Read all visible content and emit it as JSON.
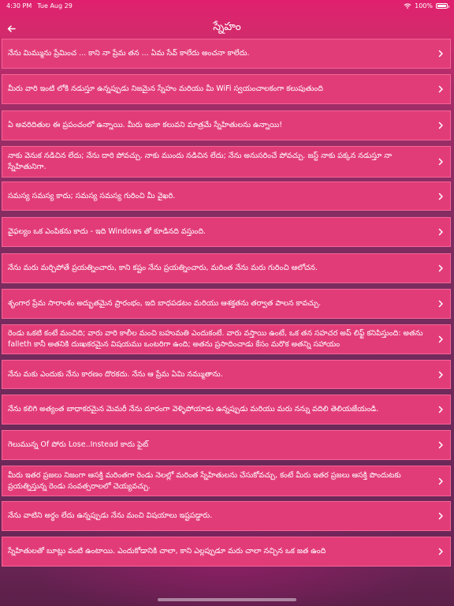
{
  "status": {
    "time": "4:30 PM",
    "date": "Tue Aug 29",
    "battery": "100%",
    "battery_level": 1.0
  },
  "header": {
    "title": "స్నేహం"
  },
  "items": [
    {
      "text": "నేను మిమ్మును ప్రేమించ ... కాని నా ప్రేమ తన ... ఏమ సేవ్ కాలేదు అంచనా కాలేదు."
    },
    {
      "text": "మీరు వారి ఇంటి లోకి నడుస్తూ ఉన్నప్పుడు నిజమైన స్నేహం మరియు మీ WiFi స్వయంచాలకంగా కలుపుతుంది"
    },
    {
      "text": "ఏ అవరిదితుల ఈ ప్రపంచంలో ఉన్నాయి. మీరు ఇంకా కలువని మాత్రమే స్నేహితులను ఉన్నాయి!"
    },
    {
      "text": "నాకు వెనుక నడిచిన లేదు; నేను దారి పోవచ్చు. నాకు ముందు నడిచిన లేదు; నేను అనుసరించే పోవచ్చు. జస్ట్ నాకు పక్కన నడుస్తూ నా స్నేహితునిగా."
    },
    {
      "text": "సమస్య సమస్య కాదు; సమస్య సమస్య గురించి మీ వైఖరి."
    },
    {
      "text": "వైఫల్యం ఒక ఎంపికను కాదు - ఇది Windows తో కూడినది వస్తుంది."
    },
    {
      "text": "నేను మరు మర్చిపోతే ప్రయత్నించారు, కాని కష్టం నేను ప్రయత్నించారు, మరింత నేను మరు గురించి ఆలోచన."
    },
    {
      "text": "శృంగార ప్రేమ సారాంశం అద్భుతమైన ప్రారంభం, ఇది బాధపడటం మరియు ఆశక్తతను తర్వాత పాలన కావచ్చు."
    },
    {
      "text": "రెండు ఒకటి కంటే మంచిది; వారు వారి కాలీల మంచి బహుమతి ఎందుకంటే. వారు వస్తాయి ఉంటే, ఒక తన సహచర అప్ లిఫ్ట్ కనిపిస్తుంది: అతను falleth కానీ అతనికి దుఃఖకరమైన విషయము ఒంటరిగా ఉంది; అతను ప్రసాదించాడు కేసం మరొక అతన్ని సహాయం"
    },
    {
      "text": "నేను మకు ఎందుకు నేను కారణం దొరకదు. నేను ఆ ప్రేమ ఏమి నమ్ముతాను."
    },
    {
      "text": "నేను కలిగి అత్యంత బాధాకరమైన మెమరీ నేను దూరంగా వెళ్ళిపోయాడు ఉన్నప్పుడు మరియు మరు నన్ను వదిలి తెలియజేయండి."
    },
    {
      "text": "గెలుమున్న Of పోరు Lose..Instead కాదు ఫైట్"
    },
    {
      "text": "మీరు ఇతర ప్రజలు నిజంగా ఆసక్తి మరింతగా రెండు నెలల్లో మరింత స్నేహితులను చేసుకోవచ్చు, కంటే మీరు ఇతర ప్రజలు ఆసక్తి పొందుటకు ప్రయత్నిస్తున్న రెండు సంవత్సరాలలో చెయ్యవచ్చు."
    },
    {
      "text": "నేను వాటిని అర్థం లేదు ఉన్నప్పుడు నేను మంచి విషయాలు ఇష్టపడ్డారు."
    },
    {
      "text": "స్నేహితులతో బూట్లు వంటి ఉంటాయి. ఎందుకోడానికి చాలా, కాని ఎల్లప్పుడూ మరు చాలా నచ్చిన ఒక జత ఉంది"
    }
  ]
}
